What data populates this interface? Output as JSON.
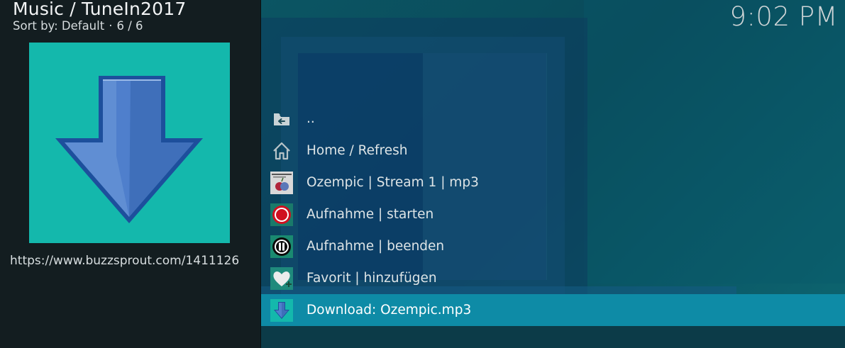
{
  "header": {
    "path": "Music / TuneIn2017",
    "sort_label": "Sort by: Default",
    "separator": "·",
    "position": "6 / 6"
  },
  "clock": {
    "time": "9:02 PM"
  },
  "info_panel": {
    "thumbnail_icon": "download-arrow-icon",
    "url": "https://www.buzzsprout.com/1411126"
  },
  "list": {
    "items": [
      {
        "label": "..",
        "icon": "parent-folder-icon"
      },
      {
        "label": "Home / Refresh",
        "icon": "home-icon"
      },
      {
        "label": "Ozempic | Stream 1 | mp3",
        "icon": "stream-thumbnail-icon"
      },
      {
        "label": "Aufnahme | starten",
        "icon": "record-icon"
      },
      {
        "label": "Aufnahme | beenden",
        "icon": "pause-icon"
      },
      {
        "label": "Favorit | hinzufügen",
        "icon": "heart-add-icon"
      },
      {
        "label": "Download: Ozempic.mp3",
        "icon": "download-icon",
        "selected": true
      }
    ]
  },
  "colors": {
    "accent_selected": "#0e8ba6",
    "thumbnail_bg": "#14b8ac",
    "panel_bg": "#131d20"
  }
}
